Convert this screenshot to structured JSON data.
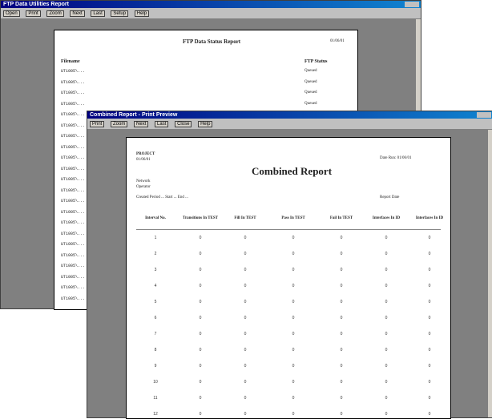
{
  "back_window": {
    "title": "FTP Data Utilities Report",
    "toolbar": [
      "Open",
      "Print",
      "Zoom",
      "Next",
      "Last",
      "Setup",
      "Help"
    ],
    "page": {
      "title": "FTP Data Status Report",
      "date": "01/06/01",
      "col_left": "Filename",
      "col_right": "FTP Status",
      "rows": [
        {
          "name": "UT1005\\...",
          "status": "Queued"
        },
        {
          "name": "UT1005\\...",
          "status": "Queued"
        },
        {
          "name": "UT1005\\...",
          "status": "Queued"
        },
        {
          "name": "UT1005\\...",
          "status": "Queued"
        },
        {
          "name": "UT1005\\...",
          "status": "Queued"
        },
        {
          "name": "UT1005\\..."
        },
        {
          "name": "UT1005\\..."
        },
        {
          "name": "UT1005\\..."
        },
        {
          "name": "UT1005\\..."
        },
        {
          "name": "UT1005\\..."
        },
        {
          "name": "UT1005\\..."
        },
        {
          "name": "UT1005\\..."
        },
        {
          "name": "UT1005\\..."
        },
        {
          "name": "UT1005\\..."
        },
        {
          "name": "UT1005\\..."
        },
        {
          "name": "UT1005\\..."
        },
        {
          "name": "UT1005\\..."
        },
        {
          "name": "UT1005\\..."
        },
        {
          "name": "UT1005\\..."
        },
        {
          "name": "UT1005\\..."
        },
        {
          "name": "UT1005\\..."
        },
        {
          "name": "UT1005\\..."
        }
      ]
    }
  },
  "front_window": {
    "title": "Combined Report - Print Preview",
    "toolbar": [
      "Print",
      "Zoom",
      "Next",
      "Last",
      "Close",
      "Help"
    ],
    "page": {
      "header_left": "PROJECT",
      "header_left_sub": "01/06/01",
      "title": "Combined Report",
      "header_right": "Date Run: 01/06/01",
      "meta1": "Network",
      "meta2": "Operator",
      "filter_line": "Created Period ... Start ... End ...",
      "filter_right": "Report Date",
      "columns": [
        "Interval No.",
        "Transitions In TEST",
        "Fill In TEST",
        "Pass In TEST",
        "Fail In TEST",
        "Interfaces In ID",
        "Interfaces In ID"
      ],
      "rows": [
        [
          "1",
          "0",
          "0",
          "0",
          "0",
          "0",
          "0"
        ],
        [
          "2",
          "0",
          "0",
          "0",
          "0",
          "0",
          "0"
        ],
        [
          "3",
          "0",
          "0",
          "0",
          "0",
          "0",
          "0"
        ],
        [
          "4",
          "0",
          "0",
          "0",
          "0",
          "0",
          "0"
        ],
        [
          "5",
          "0",
          "0",
          "0",
          "0",
          "0",
          "0"
        ],
        [
          "6",
          "0",
          "0",
          "0",
          "0",
          "0",
          "0"
        ],
        [
          "7",
          "0",
          "0",
          "0",
          "0",
          "0",
          "0"
        ],
        [
          "8",
          "0",
          "0",
          "0",
          "0",
          "0",
          "0"
        ],
        [
          "9",
          "0",
          "0",
          "0",
          "0",
          "0",
          "0"
        ],
        [
          "10",
          "0",
          "0",
          "0",
          "0",
          "0",
          "0"
        ],
        [
          "11",
          "0",
          "0",
          "0",
          "0",
          "0",
          "0"
        ],
        [
          "12",
          "0",
          "0",
          "0",
          "0",
          "0",
          "0"
        ]
      ]
    }
  }
}
